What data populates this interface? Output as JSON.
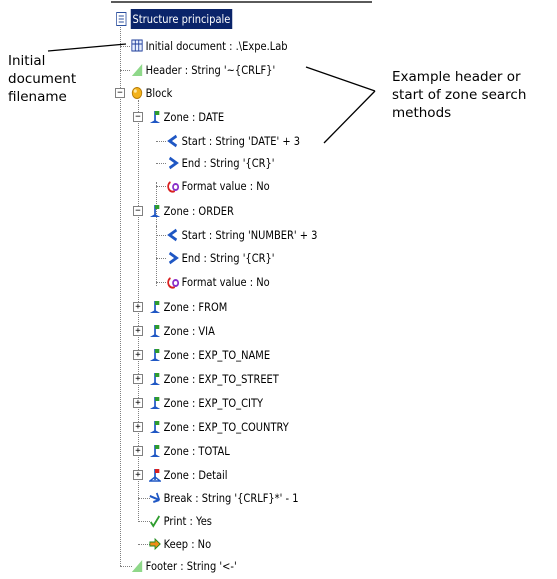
{
  "tree": {
    "root_label": "Structure principale",
    "nodes": [
      {
        "label": "Initial document : .\\Expe.Lab",
        "icon": "document-grid-icon"
      },
      {
        "label": "Header : String '~{CRLF}'",
        "icon": "header-flag-icon"
      },
      {
        "label": "Block",
        "icon": "block-ball-icon",
        "expanded": true
      },
      {
        "label": "Zone : DATE",
        "icon": "zone-icon",
        "expanded": true
      },
      {
        "label": "Start : String 'DATE' + 3",
        "icon": "start-arrow-icon"
      },
      {
        "label": "End : String '{CR}'",
        "icon": "end-arrow-icon"
      },
      {
        "label": "Format value : No",
        "icon": "format-value-icon"
      },
      {
        "label": "Zone : ORDER",
        "icon": "zone-icon",
        "expanded": true
      },
      {
        "label": "Start : String 'NUMBER' + 3",
        "icon": "start-arrow-icon"
      },
      {
        "label": "End : String '{CR}'",
        "icon": "end-arrow-icon"
      },
      {
        "label": "Format value : No",
        "icon": "format-value-icon"
      },
      {
        "label": "Zone : FROM",
        "icon": "zone-icon",
        "expanded": false
      },
      {
        "label": "Zone : VIA",
        "icon": "zone-icon",
        "expanded": false
      },
      {
        "label": "Zone : EXP_TO_NAME",
        "icon": "zone-icon",
        "expanded": false
      },
      {
        "label": "Zone : EXP_TO_STREET",
        "icon": "zone-icon",
        "expanded": false
      },
      {
        "label": "Zone : EXP_TO_CITY",
        "icon": "zone-icon",
        "expanded": false
      },
      {
        "label": "Zone : EXP_TO_COUNTRY",
        "icon": "zone-icon",
        "expanded": false
      },
      {
        "label": "Zone : TOTAL",
        "icon": "zone-icon",
        "expanded": false
      },
      {
        "label": "Zone : Detail",
        "icon": "zone-detail-icon",
        "expanded": false
      },
      {
        "label": "Break : String '{CRLF}*' - 1",
        "icon": "break-icon"
      },
      {
        "label": "Print : Yes",
        "icon": "print-check-icon"
      },
      {
        "label": "Keep : No",
        "icon": "keep-arrow-icon"
      },
      {
        "label": "Footer : String '<-'",
        "icon": "footer-flag-icon"
      }
    ]
  },
  "annotations": {
    "initial_document": [
      "Initial",
      "document",
      "filename"
    ],
    "header_example": [
      "Example header or",
      "start of zone search",
      "methods"
    ]
  },
  "colors": {
    "selection_bg": "#0a246a",
    "selection_text": "#ffffff",
    "guide_lines": "#808080"
  }
}
